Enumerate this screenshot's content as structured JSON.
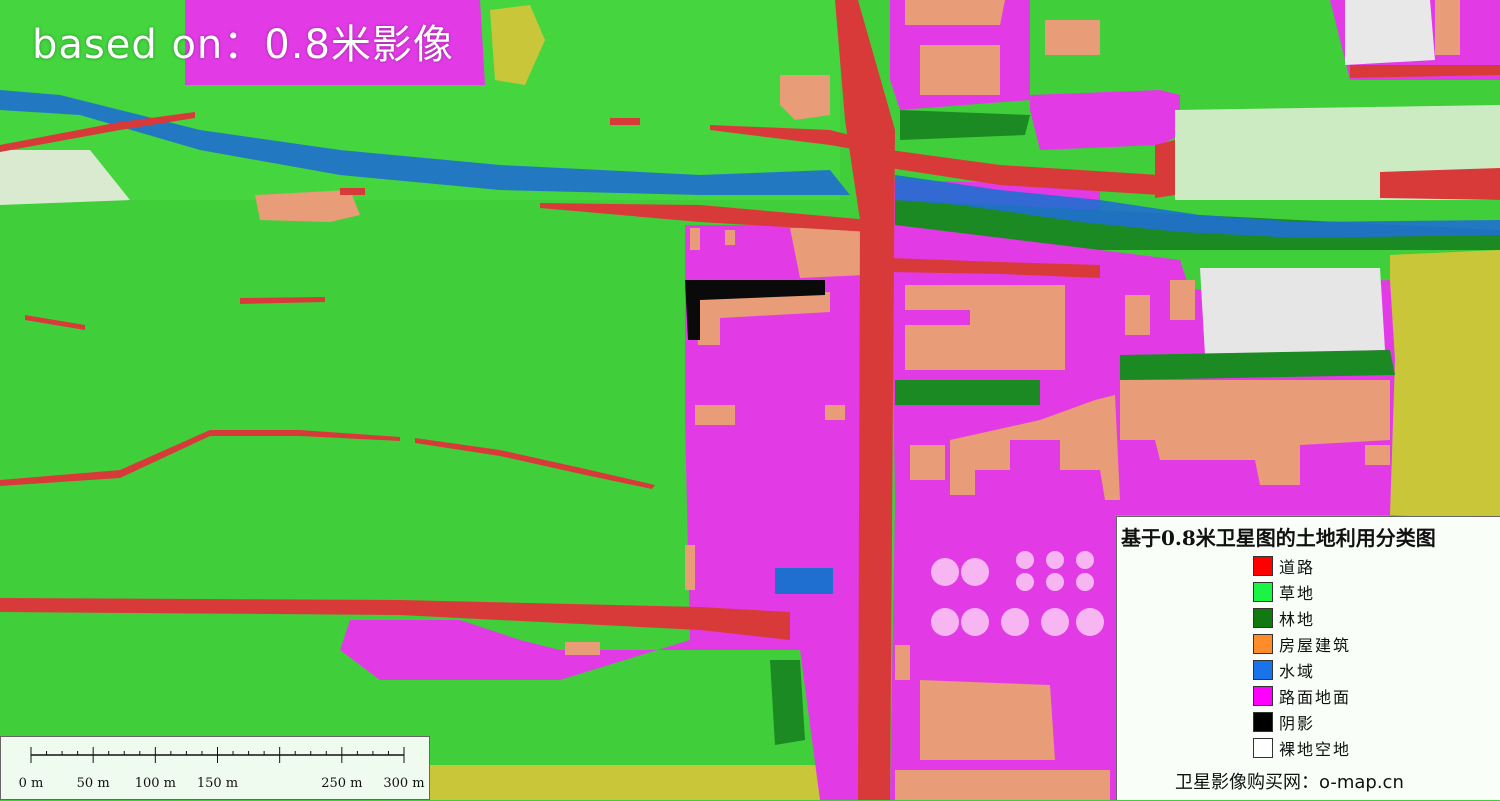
{
  "overlay_text": "based on：0.8米影像",
  "legend": {
    "title": "基于0.8米卫星图的土地利用分类图",
    "items": [
      {
        "label": "道路",
        "color": "#ff0000"
      },
      {
        "label": "草地",
        "color": "#19f542"
      },
      {
        "label": "林地",
        "color": "#107a10"
      },
      {
        "label": "房屋建筑",
        "color": "#ff8c2a"
      },
      {
        "label": "水域",
        "color": "#1a73e8"
      },
      {
        "label": "路面地面",
        "color": "#ff00ff"
      },
      {
        "label": "阴影",
        "color": "#000000"
      },
      {
        "label": "裸地空地",
        "color": "#ffffff"
      }
    ],
    "source": "卫星影像购买网：o-map.cn"
  },
  "scale_bar": {
    "ticks": [
      "0 m",
      "50 m",
      "100 m",
      "150 m",
      "250 m",
      "300 m"
    ],
    "tick_values_m": [
      0,
      50,
      100,
      150,
      250,
      300
    ]
  }
}
